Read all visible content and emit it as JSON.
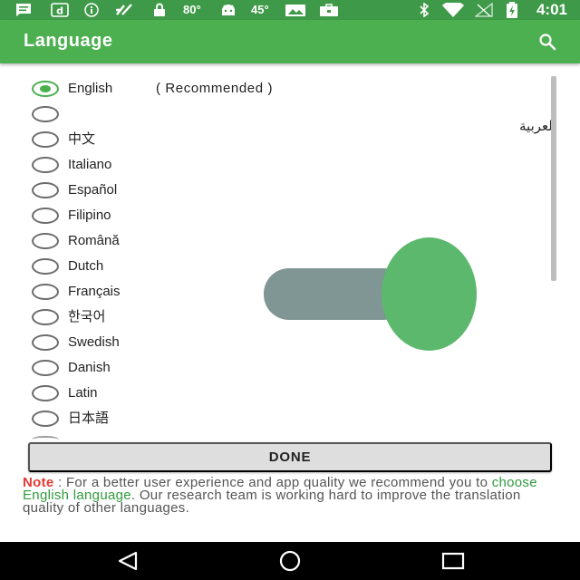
{
  "status_bar": {
    "icons": [
      "message-icon",
      "dailyhunt-icon",
      "info-icon",
      "fitness-icon",
      "lock-icon",
      "temperature-icon",
      "android-icon",
      "temperature-icon",
      "photo-icon",
      "briefcase-icon",
      "bluetooth-icon",
      "wifi-icon",
      "no-signal-icon",
      "battery-charging-icon"
    ],
    "temp1": "80°",
    "temp2": "45°",
    "time": "4:01"
  },
  "app_bar": {
    "title": "Language",
    "color": "#4caf50",
    "status_color": "#3e9a48"
  },
  "languages": [
    {
      "label": "English",
      "selected": true,
      "extra": "( Recommended )"
    },
    {
      "label": "العربية",
      "selected": false
    },
    {
      "label": "中文",
      "selected": false
    },
    {
      "label": "Italiano",
      "selected": false
    },
    {
      "label": "Español",
      "selected": false
    },
    {
      "label": "Filipino",
      "selected": false
    },
    {
      "label": "Română",
      "selected": false
    },
    {
      "label": "Dutch",
      "selected": false
    },
    {
      "label": "Français",
      "selected": false
    },
    {
      "label": "한국어",
      "selected": false
    },
    {
      "label": "Swedish",
      "selected": false
    },
    {
      "label": "Danish",
      "selected": false
    },
    {
      "label": "Latin",
      "selected": false
    },
    {
      "label": "日本語",
      "selected": false
    }
  ],
  "done_label": "DONE",
  "note": {
    "prefix": "Note",
    "part1": " : For a better user experience and app quality we recommend you to ",
    "link": "choose English language",
    "part2": ". Our research team is working hard to improve the translation quality of other languages."
  },
  "toggle": {
    "track_color": "#7f9694",
    "thumb_color": "#5cb86c"
  },
  "accent": "#4caf50"
}
